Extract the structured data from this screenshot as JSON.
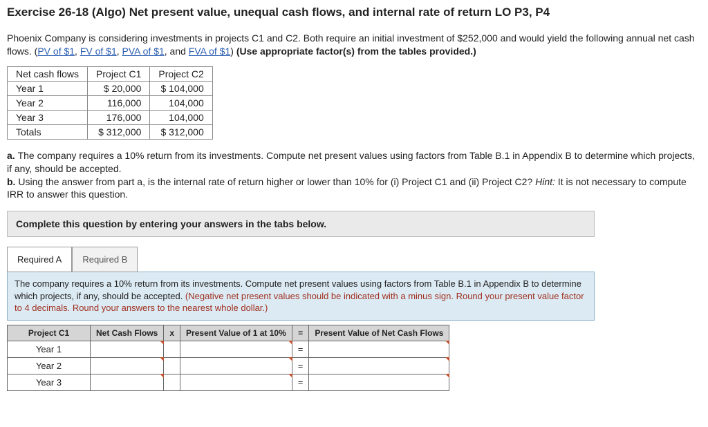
{
  "title": "Exercise 26-18 (Algo) Net present value, unequal cash flows, and internal rate of return LO P3, P4",
  "intro": {
    "p1a": "Phoenix Company is considering investments in projects C1 and C2. Both require an initial investment of $252,000 and would yield the following annual net cash flows. (",
    "links": {
      "pv": "PV of $1",
      "fv": "FV of $1",
      "pva": "PVA of $1",
      "fva": "FVA of $1"
    },
    "sep": ", ",
    "and": ", and ",
    "p1b": ") ",
    "use": "(Use appropriate factor(s) from the tables provided.)"
  },
  "cf_table": {
    "h0": "Net cash flows",
    "h1": "Project C1",
    "h2": "Project C2",
    "rows": [
      {
        "label": "Year 1",
        "c1": "$ 20,000",
        "c2": "$ 104,000"
      },
      {
        "label": "Year 2",
        "c1": "116,000",
        "c2": "104,000"
      },
      {
        "label": "Year 3",
        "c1": "176,000",
        "c2": "104,000"
      }
    ],
    "tot_label": "Totals",
    "tot_c1": "$ 312,000",
    "tot_c2": "$ 312,000"
  },
  "qa": {
    "a_lead": "a. ",
    "a": "The company requires a 10% return from its investments. Compute net present values using factors from Table B.1 in Appendix B to determine which projects, if any, should be accepted.",
    "b_lead": "b. ",
    "b1": "Using the answer from part a, is the internal rate of return higher or lower than 10% for (i) Project C1 and (ii) Project C2? ",
    "hint_lbl": "Hint:",
    "b2": " It is not necessary to compute IRR to answer this question."
  },
  "prompt": "Complete this question by entering your answers in the tabs below.",
  "tabs": {
    "a": "Required A",
    "b": "Required B"
  },
  "sub_instr": {
    "s1": "The company requires a 10% return from its investments. Compute net present values using factors from Table B.1 in Appendix B to determine which projects, if any, should be accepted. ",
    "s2": "(Negative net present values should be indicated with a minus sign. Round your present value factor to 4 decimals. Round your answers to the nearest whole dollar.)"
  },
  "ans": {
    "h_proj": "Project C1",
    "h_ncf": "Net Cash Flows",
    "h_x": "x",
    "h_pv": "Present Value of 1 at 10%",
    "h_eq": "=",
    "h_pvncf": "Present Value of Net Cash Flows",
    "r1": "Year 1",
    "r2": "Year 2",
    "r3": "Year 3",
    "eq": "="
  }
}
